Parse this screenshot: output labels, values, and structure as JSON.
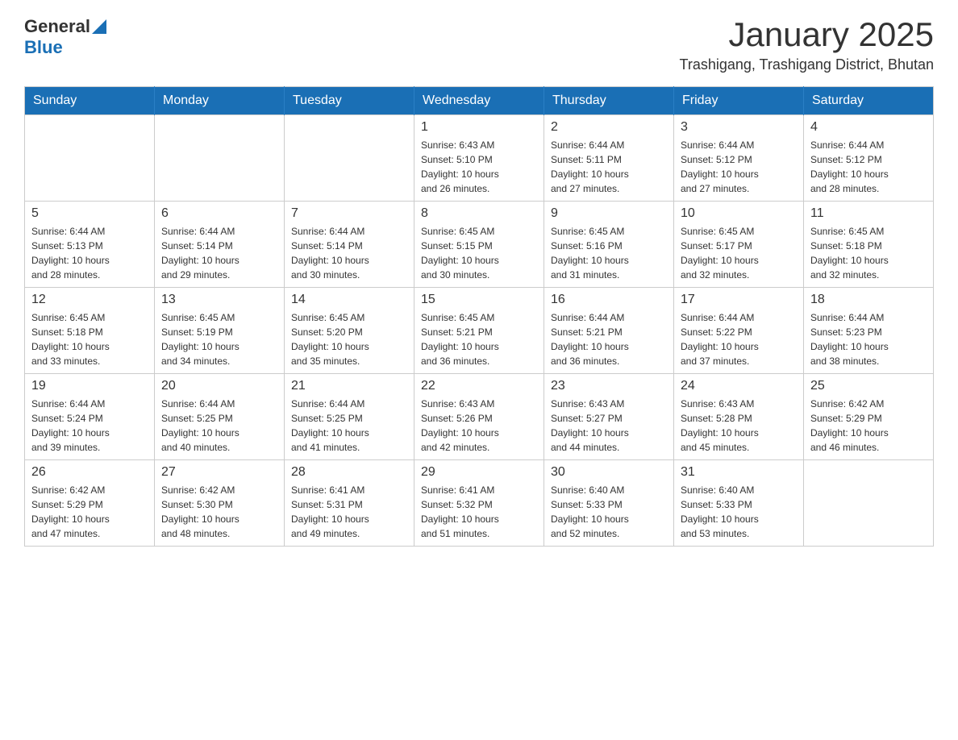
{
  "header": {
    "logo": {
      "general": "General",
      "blue": "Blue"
    },
    "title": "January 2025",
    "location": "Trashigang, Trashigang District, Bhutan"
  },
  "calendar": {
    "days_of_week": [
      "Sunday",
      "Monday",
      "Tuesday",
      "Wednesday",
      "Thursday",
      "Friday",
      "Saturday"
    ],
    "weeks": [
      [
        {
          "day": "",
          "info": ""
        },
        {
          "day": "",
          "info": ""
        },
        {
          "day": "",
          "info": ""
        },
        {
          "day": "1",
          "info": "Sunrise: 6:43 AM\nSunset: 5:10 PM\nDaylight: 10 hours\nand 26 minutes."
        },
        {
          "day": "2",
          "info": "Sunrise: 6:44 AM\nSunset: 5:11 PM\nDaylight: 10 hours\nand 27 minutes."
        },
        {
          "day": "3",
          "info": "Sunrise: 6:44 AM\nSunset: 5:12 PM\nDaylight: 10 hours\nand 27 minutes."
        },
        {
          "day": "4",
          "info": "Sunrise: 6:44 AM\nSunset: 5:12 PM\nDaylight: 10 hours\nand 28 minutes."
        }
      ],
      [
        {
          "day": "5",
          "info": "Sunrise: 6:44 AM\nSunset: 5:13 PM\nDaylight: 10 hours\nand 28 minutes."
        },
        {
          "day": "6",
          "info": "Sunrise: 6:44 AM\nSunset: 5:14 PM\nDaylight: 10 hours\nand 29 minutes."
        },
        {
          "day": "7",
          "info": "Sunrise: 6:44 AM\nSunset: 5:14 PM\nDaylight: 10 hours\nand 30 minutes."
        },
        {
          "day": "8",
          "info": "Sunrise: 6:45 AM\nSunset: 5:15 PM\nDaylight: 10 hours\nand 30 minutes."
        },
        {
          "day": "9",
          "info": "Sunrise: 6:45 AM\nSunset: 5:16 PM\nDaylight: 10 hours\nand 31 minutes."
        },
        {
          "day": "10",
          "info": "Sunrise: 6:45 AM\nSunset: 5:17 PM\nDaylight: 10 hours\nand 32 minutes."
        },
        {
          "day": "11",
          "info": "Sunrise: 6:45 AM\nSunset: 5:18 PM\nDaylight: 10 hours\nand 32 minutes."
        }
      ],
      [
        {
          "day": "12",
          "info": "Sunrise: 6:45 AM\nSunset: 5:18 PM\nDaylight: 10 hours\nand 33 minutes."
        },
        {
          "day": "13",
          "info": "Sunrise: 6:45 AM\nSunset: 5:19 PM\nDaylight: 10 hours\nand 34 minutes."
        },
        {
          "day": "14",
          "info": "Sunrise: 6:45 AM\nSunset: 5:20 PM\nDaylight: 10 hours\nand 35 minutes."
        },
        {
          "day": "15",
          "info": "Sunrise: 6:45 AM\nSunset: 5:21 PM\nDaylight: 10 hours\nand 36 minutes."
        },
        {
          "day": "16",
          "info": "Sunrise: 6:44 AM\nSunset: 5:21 PM\nDaylight: 10 hours\nand 36 minutes."
        },
        {
          "day": "17",
          "info": "Sunrise: 6:44 AM\nSunset: 5:22 PM\nDaylight: 10 hours\nand 37 minutes."
        },
        {
          "day": "18",
          "info": "Sunrise: 6:44 AM\nSunset: 5:23 PM\nDaylight: 10 hours\nand 38 minutes."
        }
      ],
      [
        {
          "day": "19",
          "info": "Sunrise: 6:44 AM\nSunset: 5:24 PM\nDaylight: 10 hours\nand 39 minutes."
        },
        {
          "day": "20",
          "info": "Sunrise: 6:44 AM\nSunset: 5:25 PM\nDaylight: 10 hours\nand 40 minutes."
        },
        {
          "day": "21",
          "info": "Sunrise: 6:44 AM\nSunset: 5:25 PM\nDaylight: 10 hours\nand 41 minutes."
        },
        {
          "day": "22",
          "info": "Sunrise: 6:43 AM\nSunset: 5:26 PM\nDaylight: 10 hours\nand 42 minutes."
        },
        {
          "day": "23",
          "info": "Sunrise: 6:43 AM\nSunset: 5:27 PM\nDaylight: 10 hours\nand 44 minutes."
        },
        {
          "day": "24",
          "info": "Sunrise: 6:43 AM\nSunset: 5:28 PM\nDaylight: 10 hours\nand 45 minutes."
        },
        {
          "day": "25",
          "info": "Sunrise: 6:42 AM\nSunset: 5:29 PM\nDaylight: 10 hours\nand 46 minutes."
        }
      ],
      [
        {
          "day": "26",
          "info": "Sunrise: 6:42 AM\nSunset: 5:29 PM\nDaylight: 10 hours\nand 47 minutes."
        },
        {
          "day": "27",
          "info": "Sunrise: 6:42 AM\nSunset: 5:30 PM\nDaylight: 10 hours\nand 48 minutes."
        },
        {
          "day": "28",
          "info": "Sunrise: 6:41 AM\nSunset: 5:31 PM\nDaylight: 10 hours\nand 49 minutes."
        },
        {
          "day": "29",
          "info": "Sunrise: 6:41 AM\nSunset: 5:32 PM\nDaylight: 10 hours\nand 51 minutes."
        },
        {
          "day": "30",
          "info": "Sunrise: 6:40 AM\nSunset: 5:33 PM\nDaylight: 10 hours\nand 52 minutes."
        },
        {
          "day": "31",
          "info": "Sunrise: 6:40 AM\nSunset: 5:33 PM\nDaylight: 10 hours\nand 53 minutes."
        },
        {
          "day": "",
          "info": ""
        }
      ]
    ]
  }
}
